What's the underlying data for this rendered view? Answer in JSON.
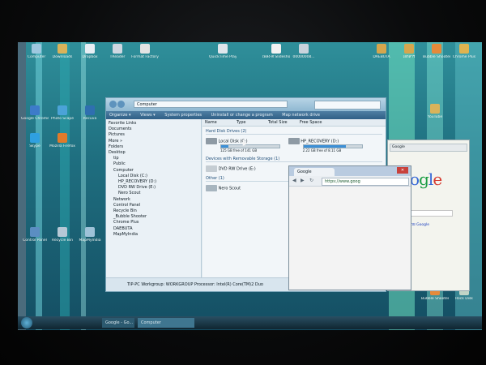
{
  "desktop": {
    "icons": [
      {
        "label": "Computer",
        "x": 0
      },
      {
        "label": "Downloads",
        "x": 0
      },
      {
        "label": "Dropbox",
        "x": 0
      },
      {
        "label": "TReader",
        "x": 0
      },
      {
        "label": "Format Factory",
        "x": 0
      },
      {
        "label": "QuickTime Player",
        "x": 0
      },
      {
        "label": "เพลง-ดี Slideshow",
        "x": 0
      },
      {
        "label": "0000000อ...",
        "x": 0
      },
      {
        "label": "DAEBUTA",
        "x": 0
      },
      {
        "label": "เอกสาร",
        "x": 0
      },
      {
        "label": "Bubble Shooter",
        "x": 0
      },
      {
        "label": "Chrome Plus",
        "x": 0
      },
      {
        "label": "Google Chrome",
        "x": 0
      },
      {
        "label": "YouTube",
        "x": 0
      },
      {
        "label": "Photo Scape",
        "x": 0
      },
      {
        "label": "Recuva",
        "x": 0
      },
      {
        "label": "Skype",
        "x": 0
      },
      {
        "label": "Mozilla Firefox",
        "x": 0
      },
      {
        "label": "Control Panel",
        "x": 0
      },
      {
        "label": "Recycle Bin",
        "x": 0
      },
      {
        "label": "MapMyIndia",
        "x": 0
      },
      {
        "label": "Bubble Shooter",
        "x": 0
      },
      {
        "label": "Rock Disk",
        "x": 0
      }
    ]
  },
  "explorer": {
    "address": "Computer",
    "toolbar": [
      "Organize ▾",
      "Views ▾",
      "System properties",
      "Uninstall or change a program",
      "Map network drive"
    ],
    "columns": [
      "Name",
      "Type",
      "Total Size",
      "Free Space"
    ],
    "sidebar": [
      "Favorite Links",
      "Documents",
      "Pictures",
      "More »",
      "Folders",
      "Desktop",
      "tip",
      "Public",
      "Computer",
      "Local Disk (C:)",
      "HP_RECOVERY (D:)",
      "DVD RW Drive (E:)",
      "Nero Scout",
      "Network",
      "Control Panel",
      "Recycle Bin",
      "_Bubble Shooter",
      "Chrome Plus",
      "DAEBUTA",
      "MapMyIndia"
    ],
    "groups": {
      "hard_disks": "Hard Disk Drives (2)",
      "removable": "Devices with Removable Storage (1)",
      "other": "Other (1)"
    },
    "drives": [
      {
        "name": "Local Disk (C:)",
        "free_text": "125 GB free of 141 GB",
        "used_fraction": 0.12
      },
      {
        "name": "HP_RECOVERY (D:)",
        "free_text": "2.22 GB free of 8.11 GB",
        "used_fraction": 0.73
      }
    ],
    "dvd": "DVD RW Drive (E:)",
    "other_item": "Nero Scout",
    "status": "TIP-PC  Workgroup: WORKGROUP    Processor: Intel(R) Core(TM)2 Duo"
  },
  "chrome": {
    "tab": "Google",
    "url": "https://www.goog"
  },
  "bgbrowser": {
    "url": "Google",
    "logo": "oogle",
    "text": "ค้นหาด้วย Google"
  },
  "taskbar": {
    "items": [
      "Google - Go...",
      "Computer"
    ]
  },
  "colors": {
    "screen": "#1f6f80",
    "toolbar": "#2f5f86",
    "progress": "#3c8fd6",
    "close": "#c8413b"
  }
}
